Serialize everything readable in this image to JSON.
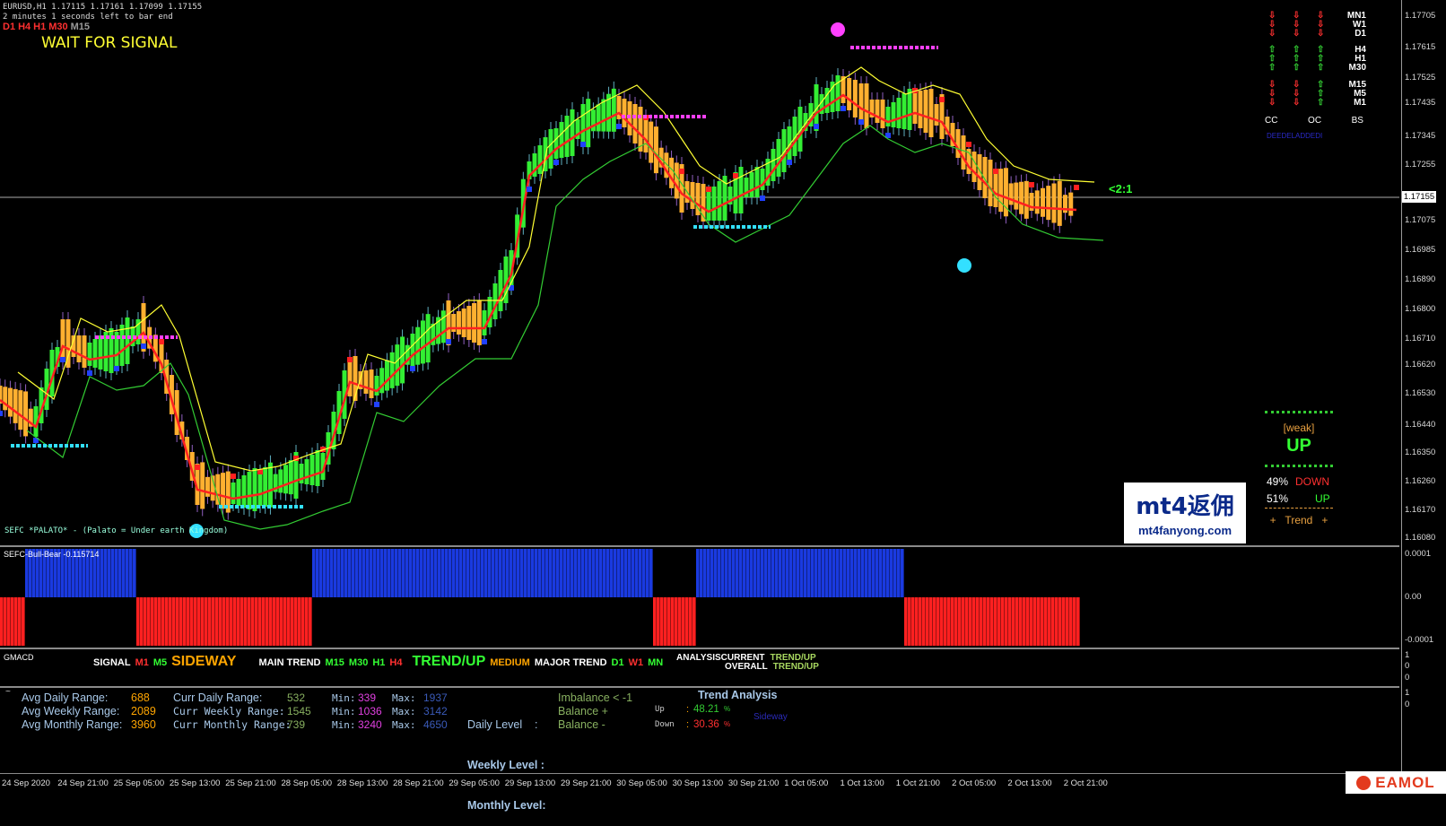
{
  "header": {
    "symbol": "EURUSD,H1  1.17115 1.17161 1.17099 1.17155",
    "countdown": "2 minutes 1 seconds left to bar end",
    "tf_strip": [
      {
        "label": "D1",
        "color": "#ff3030"
      },
      {
        "label": "H4",
        "color": "#ff3030"
      },
      {
        "label": "H1",
        "color": "#ff3030"
      },
      {
        "label": "M30",
        "color": "#ff3030"
      },
      {
        "label": "M15",
        "color": "#9a9a9a"
      }
    ],
    "signal": "WAIT FOR SIGNAL",
    "signal_color": "#ffff33"
  },
  "price_axis": {
    "ticks": [
      "1.17705",
      "1.17615",
      "1.17525",
      "1.17435",
      "1.17345",
      "1.17255",
      "1.17155",
      "1.17075",
      "1.16985",
      "1.16890",
      "1.16800",
      "1.16710",
      "1.16620",
      "1.16530",
      "1.16440",
      "1.16350",
      "1.16260",
      "1.16170",
      "1.16080"
    ],
    "current_price": "1.17155"
  },
  "tf_panel": {
    "labels": [
      "MN1",
      "W1",
      "D1",
      "H4",
      "H1",
      "M30",
      "M15",
      "M5",
      "M1"
    ],
    "columns": [
      "CC",
      "OC",
      "BS"
    ],
    "note": "DEEDELADDEDI"
  },
  "ratio_label": "<2:1",
  "strength_box": {
    "weak": "[weak]",
    "direction": "UP",
    "down_pct": "49%",
    "down_label": "DOWN",
    "up_pct": "51%",
    "up_label": "UP",
    "trend": "+   Trend   +"
  },
  "watermark": {
    "brand": "mt4返佣",
    "url": "mt4fanyong.com"
  },
  "indicator_note": "SEFC *PALATO* - (Palato = Under earth Kingdom)",
  "bullbear": {
    "title": "SEFC-Bull-Bear -0.115714",
    "axis": [
      "0.0001",
      "0.00",
      "-0.0001"
    ]
  },
  "gmacd": {
    "title": "GMACD",
    "signal_label": "SIGNAL",
    "signal_m1": "M1",
    "signal_m5": "M5",
    "signal_state": "SIDEWAY",
    "main_label": "MAIN TREND",
    "main_m15": "M15",
    "main_m30": "M30",
    "main_h1": "H1",
    "main_h4": "H4",
    "main_state": "TREND/UP",
    "medium": "MEDIUM",
    "major_label": "MAJOR TREND",
    "major_d1": "D1",
    "major_w1": "W1",
    "major_mn": "MN",
    "analysis": "ANALYSIS",
    "current": "CURRENT",
    "overall": "OVERALL",
    "current_state": "TREND/UP",
    "overall_state": "TREND/UP",
    "axis": [
      "1",
      "0",
      "0"
    ]
  },
  "ranges": {
    "avg_daily_label": "Avg Daily Range:",
    "avg_daily": "688",
    "avg_weekly_label": "Avg Weekly Range:",
    "avg_weekly": "2089",
    "avg_monthly_label": "Avg Monthly Range:",
    "avg_monthly": "3960",
    "curr_daily_label": "Curr Daily Range:",
    "curr_daily": "532",
    "curr_weekly_label": "Curr Weekly Range:",
    "curr_weekly": "1545",
    "curr_monthly_label": "Curr Monthly Range:",
    "curr_monthly": "739",
    "min_label": "Min:",
    "max_label": "Max:",
    "min_d": "339",
    "max_d": "1937",
    "min_w": "1036",
    "max_w": "3142",
    "min_m": "3240",
    "max_m": "4650",
    "daily_level_label": "Daily Level    :",
    "daily_level": "Imbalance < -1",
    "weekly_level_label": "Weekly Level :",
    "weekly_level": "Balance +",
    "monthly_level_label": "Monthly Level:",
    "monthly_level": "Balance -",
    "trend_analysis": "Trend Analysis",
    "up_label": "Up",
    "up_val": "48.21",
    "down_label": "Down",
    "down_val": "30.36",
    "pct": "%",
    "sideway": "Sideway",
    "axis": [
      "1",
      "0"
    ]
  },
  "x_axis": [
    "24 Sep 2020",
    "24 Sep 21:00",
    "25 Sep 05:00",
    "25 Sep 13:00",
    "25 Sep 21:00",
    "28 Sep 05:00",
    "28 Sep 13:00",
    "28 Sep 21:00",
    "29 Sep 05:00",
    "29 Sep 13:00",
    "29 Sep 21:00",
    "30 Sep 05:00",
    "30 Sep 13:00",
    "30 Sep 21:00",
    "1 Oct 05:00",
    "1 Oct 13:00",
    "1 Oct 21:00",
    "2 Oct 05:00",
    "2 Oct 13:00",
    "2 Oct 21:00"
  ],
  "footer_brand": "EAMOL"
}
